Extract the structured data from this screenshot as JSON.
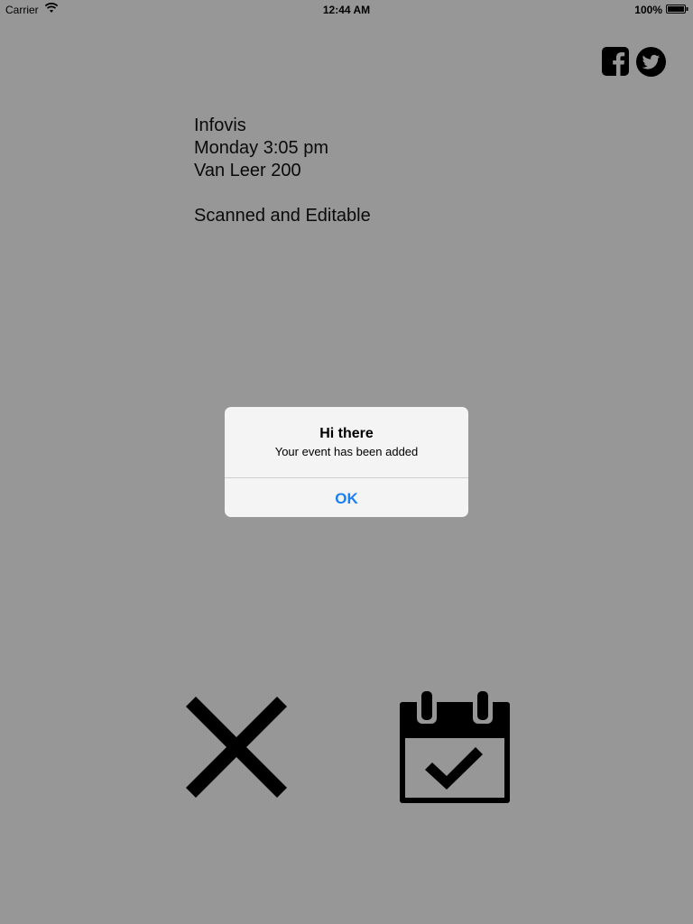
{
  "status_bar": {
    "carrier": "Carrier",
    "time": "12:44 AM",
    "battery": "100%",
    "icons": [
      "wifi-icon",
      "battery-icon"
    ]
  },
  "social": {
    "icons": [
      "facebook-icon",
      "twitter-icon"
    ]
  },
  "event": {
    "name": "Infovis",
    "datetime": "Monday 3:05 pm",
    "location": "Van Leer 200",
    "status": "Scanned and Editable"
  },
  "alert": {
    "title": "Hi there",
    "message": "Your event has been added",
    "ok_label": "OK",
    "ok_color": "#1a7ff0"
  },
  "actions": {
    "icons": [
      "close-icon",
      "calendar-check-icon"
    ]
  },
  "colors": {
    "background": "#979797",
    "alert_background": "#f4f4f4"
  }
}
